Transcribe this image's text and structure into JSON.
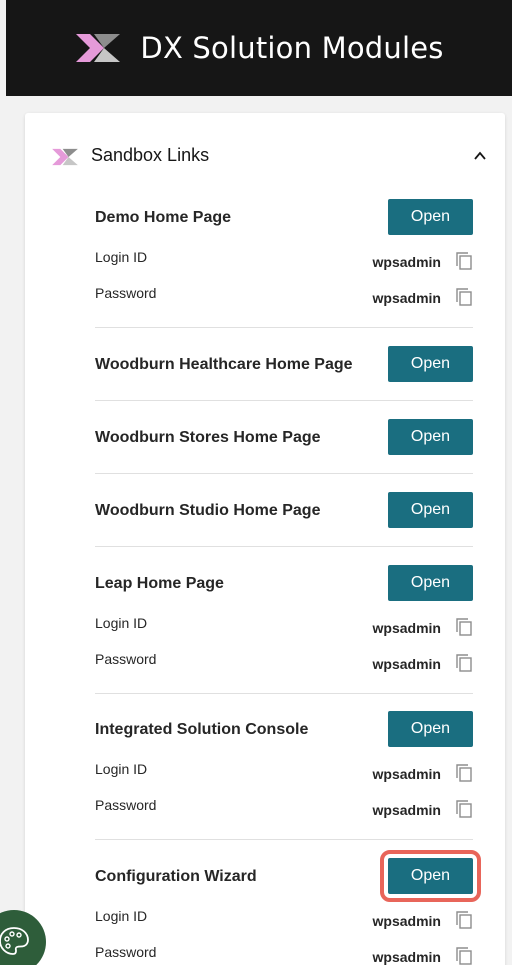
{
  "header": {
    "title": "DX Solution Modules",
    "logo_icon": "dx-logo-icon"
  },
  "section": {
    "title": "Sandbox Links",
    "collapse_icon": "chevron-up-icon"
  },
  "items": [
    {
      "title": "Demo Home Page",
      "button": "Open",
      "credentials": {
        "login_label": "Login ID",
        "login_value": "wpsadmin",
        "password_label": "Password",
        "password_value": "wpsadmin"
      }
    },
    {
      "title": "Woodburn Healthcare Home Page",
      "button": "Open"
    },
    {
      "title": "Woodburn Stores Home Page",
      "button": "Open"
    },
    {
      "title": "Woodburn Studio Home Page",
      "button": "Open"
    },
    {
      "title": "Leap Home Page",
      "button": "Open",
      "credentials": {
        "login_label": "Login ID",
        "login_value": "wpsadmin",
        "password_label": "Password",
        "password_value": "wpsadmin"
      }
    },
    {
      "title": "Integrated Solution Console",
      "button": "Open",
      "credentials": {
        "login_label": "Login ID",
        "login_value": "wpsadmin",
        "password_label": "Password",
        "password_value": "wpsadmin"
      }
    },
    {
      "title": "Configuration Wizard",
      "button": "Open",
      "credentials": {
        "login_label": "Login ID",
        "login_value": "wpsadmin",
        "password_label": "Password",
        "password_value": "wpsadmin"
      }
    }
  ],
  "colors": {
    "header_bg": "#161616",
    "button_bg": "#1a6e80",
    "highlight": "#e8655a",
    "logo_pink": "#e59ad9",
    "logo_gray": "#8d8d8d",
    "palette_bg": "#2e5d3a"
  }
}
